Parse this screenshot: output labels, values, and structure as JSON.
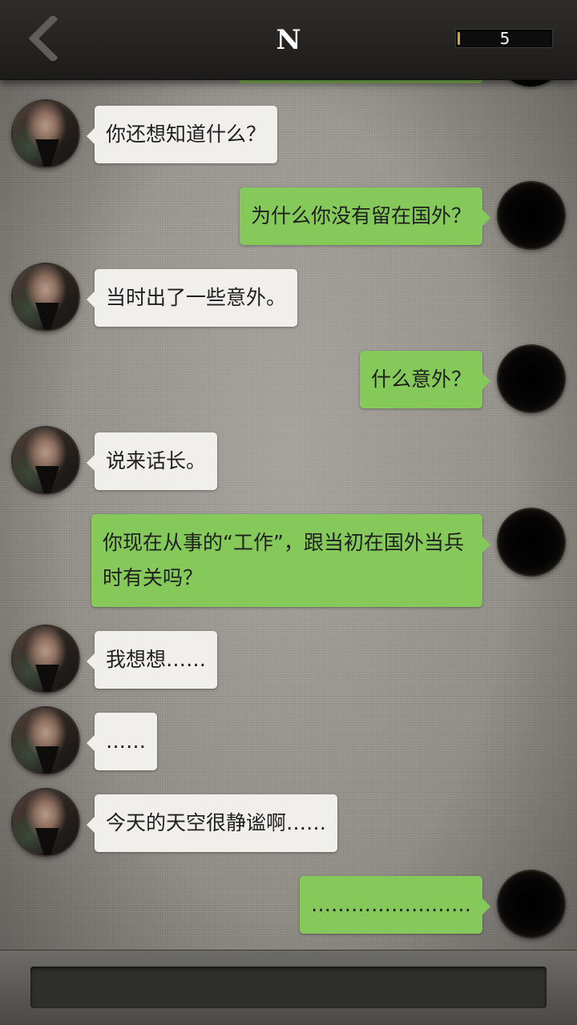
{
  "header": {
    "title": "N",
    "counter": "5",
    "back_icon": "chevron-left-icon"
  },
  "colors": {
    "header_bg": "#1f1e1d",
    "my_bubble": "#84c95a",
    "friend_bubble": "#f1efec",
    "counter_accent": "#d7a73a"
  },
  "messages": [
    {
      "sender": "friend",
      "text": "你还想知道什么？"
    },
    {
      "sender": "me",
      "text": "为什么你没有留在国外？"
    },
    {
      "sender": "friend",
      "text": "当时出了一些意外。"
    },
    {
      "sender": "me",
      "text": "什么意外？"
    },
    {
      "sender": "friend",
      "text": "说来话长。"
    },
    {
      "sender": "me",
      "text": "你现在从事的“工作”，跟当初在国外当兵时有关吗？"
    },
    {
      "sender": "friend",
      "text": "我想想……"
    },
    {
      "sender": "friend",
      "text": "……"
    },
    {
      "sender": "friend",
      "text": "今天的天空很静谧啊……"
    },
    {
      "sender": "me",
      "text": "……………………"
    }
  ]
}
